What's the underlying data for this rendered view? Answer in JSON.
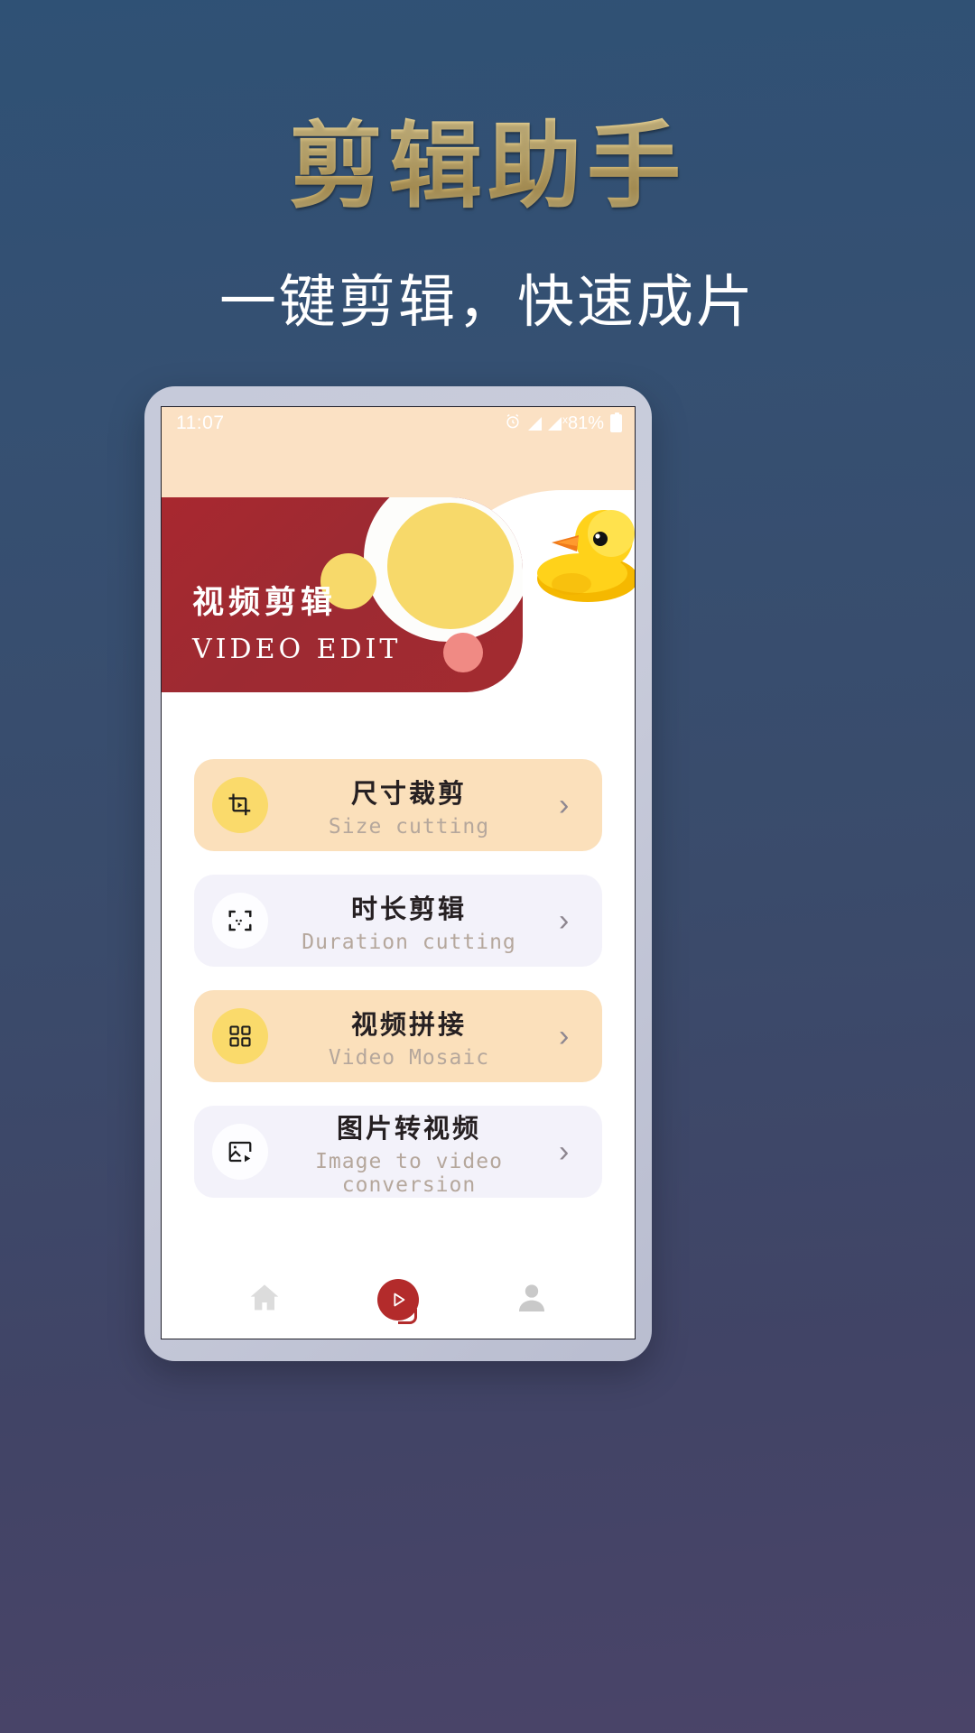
{
  "hero": {
    "title": "剪辑助手",
    "subtitle": "一键剪辑，快速成片",
    "title_color": "#d6bd7c",
    "subtitle_color": "#ffffff",
    "background_color": "#35506f"
  },
  "phone": {
    "statusbar": {
      "time": "11:07",
      "alarm_icon": "alarm-clock-icon",
      "signal_icon": "signal-bars-icon",
      "signal_x_label": "x",
      "battery_percent": "81%",
      "battery_icon": "battery-icon"
    },
    "banner": {
      "title_cn": "视频剪辑",
      "title_en": "VIDEO EDIT",
      "card_color": "#a3282f",
      "background_color": "#fbe1c4",
      "duck_illustration": "rubber-duck-illustration"
    },
    "menu": {
      "items": [
        {
          "title_cn": "尺寸裁剪",
          "title_en": "Size cutting",
          "icon": "crop-video-icon",
          "theme": "warm",
          "card_color": "#fbe0bb",
          "icon_bg": "#fada6b",
          "chevron": "›"
        },
        {
          "title_cn": "时长剪辑",
          "title_en": "Duration cutting",
          "icon": "scan-frame-icon",
          "theme": "cool",
          "card_color": "#f3f2fa",
          "icon_bg": "#fdfdff",
          "chevron": "›"
        },
        {
          "title_cn": "视频拼接",
          "title_en": "Video Mosaic",
          "icon": "grid-tiles-icon",
          "theme": "warm",
          "card_color": "#fbe0bb",
          "icon_bg": "#fada6b",
          "chevron": "›"
        },
        {
          "title_cn": "图片转视频",
          "title_en": "Image to video conversion",
          "icon": "image-to-video-icon",
          "theme": "cool",
          "card_color": "#f3f2fa",
          "icon_bg": "#fdfdff",
          "chevron": "›"
        }
      ]
    },
    "tabbar": {
      "items": [
        {
          "icon": "home-icon",
          "active": false
        },
        {
          "icon": "play-circle-icon",
          "active": true
        },
        {
          "icon": "person-icon",
          "active": false
        }
      ],
      "active_color": "#b32b2b",
      "inactive_color": "#dcdcdc"
    }
  }
}
